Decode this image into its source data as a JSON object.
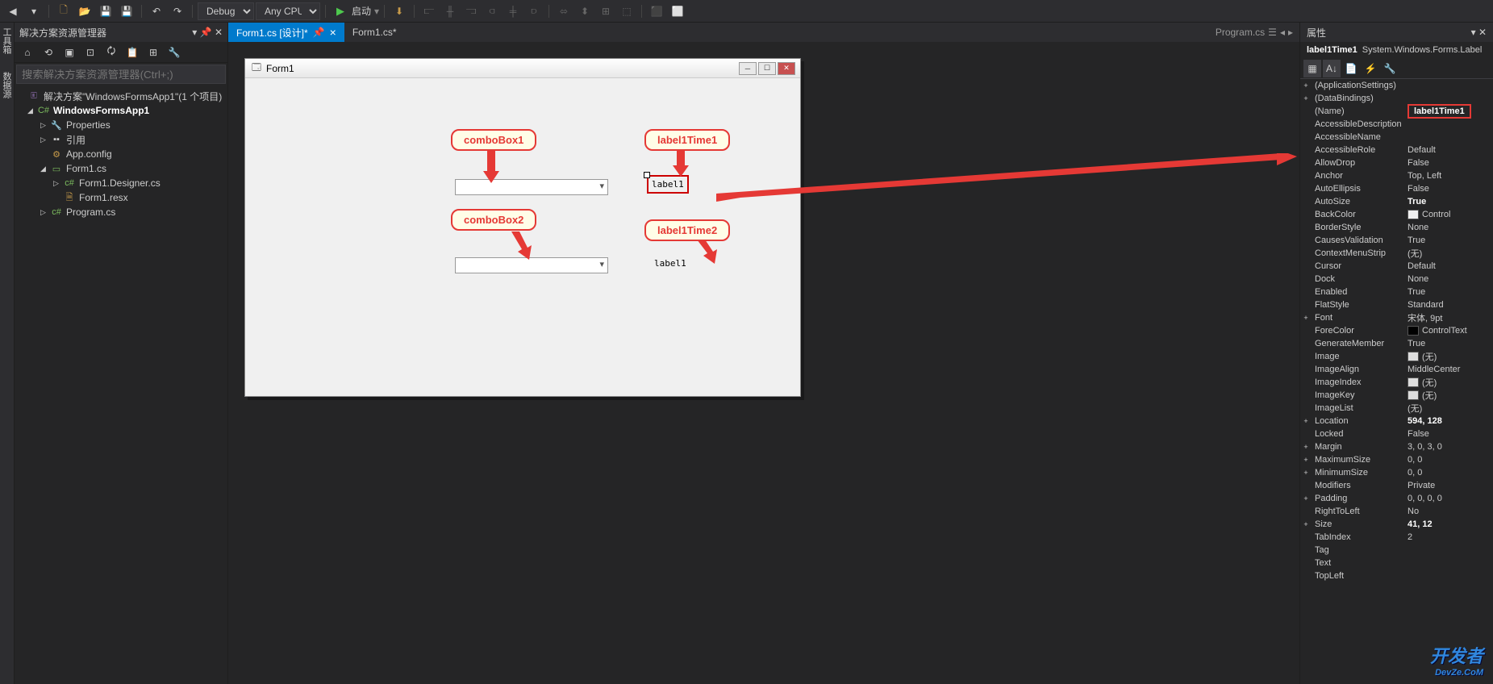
{
  "toolbar": {
    "config": "Debug",
    "platform": "Any CPU",
    "start_label": "启动"
  },
  "sidebar_vertical": [
    "工具箱",
    "数据源"
  ],
  "solution": {
    "title": "解决方案资源管理器",
    "search_placeholder": "搜索解决方案资源管理器(Ctrl+;)",
    "root": "解决方案\"WindowsFormsApp1\"(1 个项目)",
    "project": "WindowsFormsApp1",
    "items": {
      "properties": "Properties",
      "references": "引用",
      "appconfig": "App.config",
      "form1cs": "Form1.cs",
      "form1designer": "Form1.Designer.cs",
      "form1resx": "Form1.resx",
      "programcs": "Program.cs"
    }
  },
  "tabs": {
    "active": "Form1.cs [设计]*",
    "second": "Form1.cs*",
    "nav": "Program.cs"
  },
  "designer": {
    "form_title": "Form1",
    "combo1_callout": "comboBox1",
    "combo2_callout": "comboBox2",
    "label1_callout": "label1Time1",
    "label2_callout": "label1Time2",
    "label1_text": "label1",
    "label2_text": "label1"
  },
  "properties": {
    "title": "属性",
    "selected_name": "label1Time1",
    "selected_type": "System.Windows.Forms.Label",
    "rows": [
      {
        "exp": "+",
        "key": "(ApplicationSettings)",
        "val": ""
      },
      {
        "exp": "+",
        "key": "(DataBindings)",
        "val": ""
      },
      {
        "exp": "",
        "key": "(Name)",
        "val": "label1Time1",
        "highlight": true
      },
      {
        "exp": "",
        "key": "AccessibleDescription",
        "val": ""
      },
      {
        "exp": "",
        "key": "AccessibleName",
        "val": ""
      },
      {
        "exp": "",
        "key": "AccessibleRole",
        "val": "Default"
      },
      {
        "exp": "",
        "key": "AllowDrop",
        "val": "False"
      },
      {
        "exp": "",
        "key": "Anchor",
        "val": "Top, Left"
      },
      {
        "exp": "",
        "key": "AutoEllipsis",
        "val": "False"
      },
      {
        "exp": "",
        "key": "AutoSize",
        "val": "True",
        "bold": true
      },
      {
        "exp": "",
        "key": "BackColor",
        "val": "Control",
        "swatch": "#f0f0f0"
      },
      {
        "exp": "",
        "key": "BorderStyle",
        "val": "None"
      },
      {
        "exp": "",
        "key": "CausesValidation",
        "val": "True"
      },
      {
        "exp": "",
        "key": "ContextMenuStrip",
        "val": "(无)"
      },
      {
        "exp": "",
        "key": "Cursor",
        "val": "Default"
      },
      {
        "exp": "",
        "key": "Dock",
        "val": "None"
      },
      {
        "exp": "",
        "key": "Enabled",
        "val": "True"
      },
      {
        "exp": "",
        "key": "FlatStyle",
        "val": "Standard"
      },
      {
        "exp": "+",
        "key": "Font",
        "val": "宋体, 9pt"
      },
      {
        "exp": "",
        "key": "ForeColor",
        "val": "ControlText",
        "swatch": "#000"
      },
      {
        "exp": "",
        "key": "GenerateMember",
        "val": "True"
      },
      {
        "exp": "",
        "key": "Image",
        "val": "(无)",
        "swatch": "#ddd"
      },
      {
        "exp": "",
        "key": "ImageAlign",
        "val": "MiddleCenter"
      },
      {
        "exp": "",
        "key": "ImageIndex",
        "val": "(无)",
        "swatch": "#ddd"
      },
      {
        "exp": "",
        "key": "ImageKey",
        "val": "(无)",
        "swatch": "#ddd"
      },
      {
        "exp": "",
        "key": "ImageList",
        "val": "(无)"
      },
      {
        "exp": "+",
        "key": "Location",
        "val": "594, 128",
        "bold": true
      },
      {
        "exp": "",
        "key": "Locked",
        "val": "False"
      },
      {
        "exp": "+",
        "key": "Margin",
        "val": "3, 0, 3, 0"
      },
      {
        "exp": "+",
        "key": "MaximumSize",
        "val": "0, 0"
      },
      {
        "exp": "+",
        "key": "MinimumSize",
        "val": "0, 0"
      },
      {
        "exp": "",
        "key": "Modifiers",
        "val": "Private"
      },
      {
        "exp": "+",
        "key": "Padding",
        "val": "0, 0, 0, 0"
      },
      {
        "exp": "",
        "key": "RightToLeft",
        "val": "No"
      },
      {
        "exp": "+",
        "key": "Size",
        "val": "41, 12",
        "bold": true
      },
      {
        "exp": "",
        "key": "TabIndex",
        "val": "2"
      },
      {
        "exp": "",
        "key": "Tag",
        "val": ""
      },
      {
        "exp": "",
        "key": "Text",
        "val": ""
      },
      {
        "exp": "",
        "key": "TopLeft",
        "val": ""
      }
    ]
  },
  "watermark": {
    "main": "开发者",
    "sub": "DevZe.CoM"
  }
}
